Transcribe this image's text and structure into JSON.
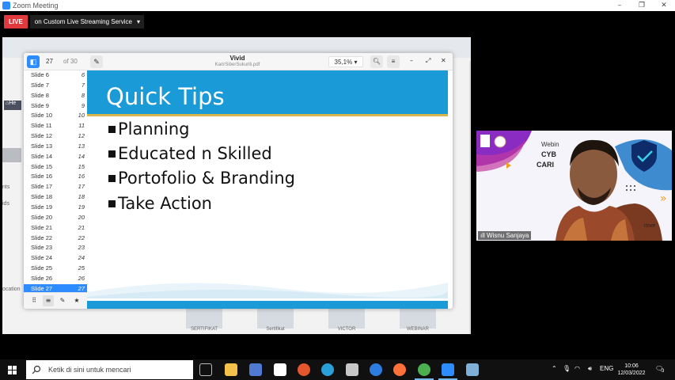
{
  "window": {
    "title": "Zoom Meeting",
    "controls": [
      "–",
      "❐",
      "✕"
    ]
  },
  "live": {
    "badge": "LIVE",
    "service": "on Custom Live Streaming Service",
    "dropdown_icon": "▾"
  },
  "background_page": {
    "left_items": [
      "He",
      "nts",
      "ids",
      "ocation"
    ],
    "bottom_cards": [
      "SERTIFIKAT",
      "Sertifikat",
      "VICTOR",
      "WEBINAR"
    ]
  },
  "viewer": {
    "page_current": "27",
    "page_total_label": "of 30",
    "doc_title": "Vivid",
    "doc_file": "KarirSiberSukuriti.pdf",
    "zoom": "35,1% ▾",
    "slides": [
      {
        "label": "Slide 6",
        "num": "6"
      },
      {
        "label": "Slide 7",
        "num": "7"
      },
      {
        "label": "Slide 8",
        "num": "8"
      },
      {
        "label": "Slide 9",
        "num": "9"
      },
      {
        "label": "Slide 10",
        "num": "10"
      },
      {
        "label": "Slide 11",
        "num": "11"
      },
      {
        "label": "Slide 12",
        "num": "12"
      },
      {
        "label": "Slide 13",
        "num": "13"
      },
      {
        "label": "Slide 14",
        "num": "14"
      },
      {
        "label": "Slide 15",
        "num": "15"
      },
      {
        "label": "Slide 16",
        "num": "16"
      },
      {
        "label": "Slide 17",
        "num": "17"
      },
      {
        "label": "Slide 18",
        "num": "18"
      },
      {
        "label": "Slide 19",
        "num": "19"
      },
      {
        "label": "Slide 20",
        "num": "20"
      },
      {
        "label": "Slide 21",
        "num": "21"
      },
      {
        "label": "Slide 22",
        "num": "22"
      },
      {
        "label": "Slide 23",
        "num": "23"
      },
      {
        "label": "Slide 24",
        "num": "24"
      },
      {
        "label": "Slide 25",
        "num": "25"
      },
      {
        "label": "Slide 26",
        "num": "26"
      },
      {
        "label": "Slide 27",
        "num": "27"
      }
    ],
    "active_slide": "Slide 27"
  },
  "slide": {
    "title": "Quick Tips",
    "bullets": [
      "Planning",
      "Educated n Skilled",
      "Portofolio & Branding",
      "Take Action"
    ],
    "accent_color": "#1a9ad6",
    "line_color": "#d8b54a"
  },
  "video": {
    "participant": "Wisnu Sanjaya",
    "banner_text": [
      "Webin",
      "CYB",
      "CARI",
      "rtner"
    ]
  },
  "taskbar": {
    "search_placeholder": "Ketik di sini untuk mencari",
    "language": "ENG",
    "time": "10:06",
    "date": "12/03/2022",
    "notification_count": "3"
  }
}
